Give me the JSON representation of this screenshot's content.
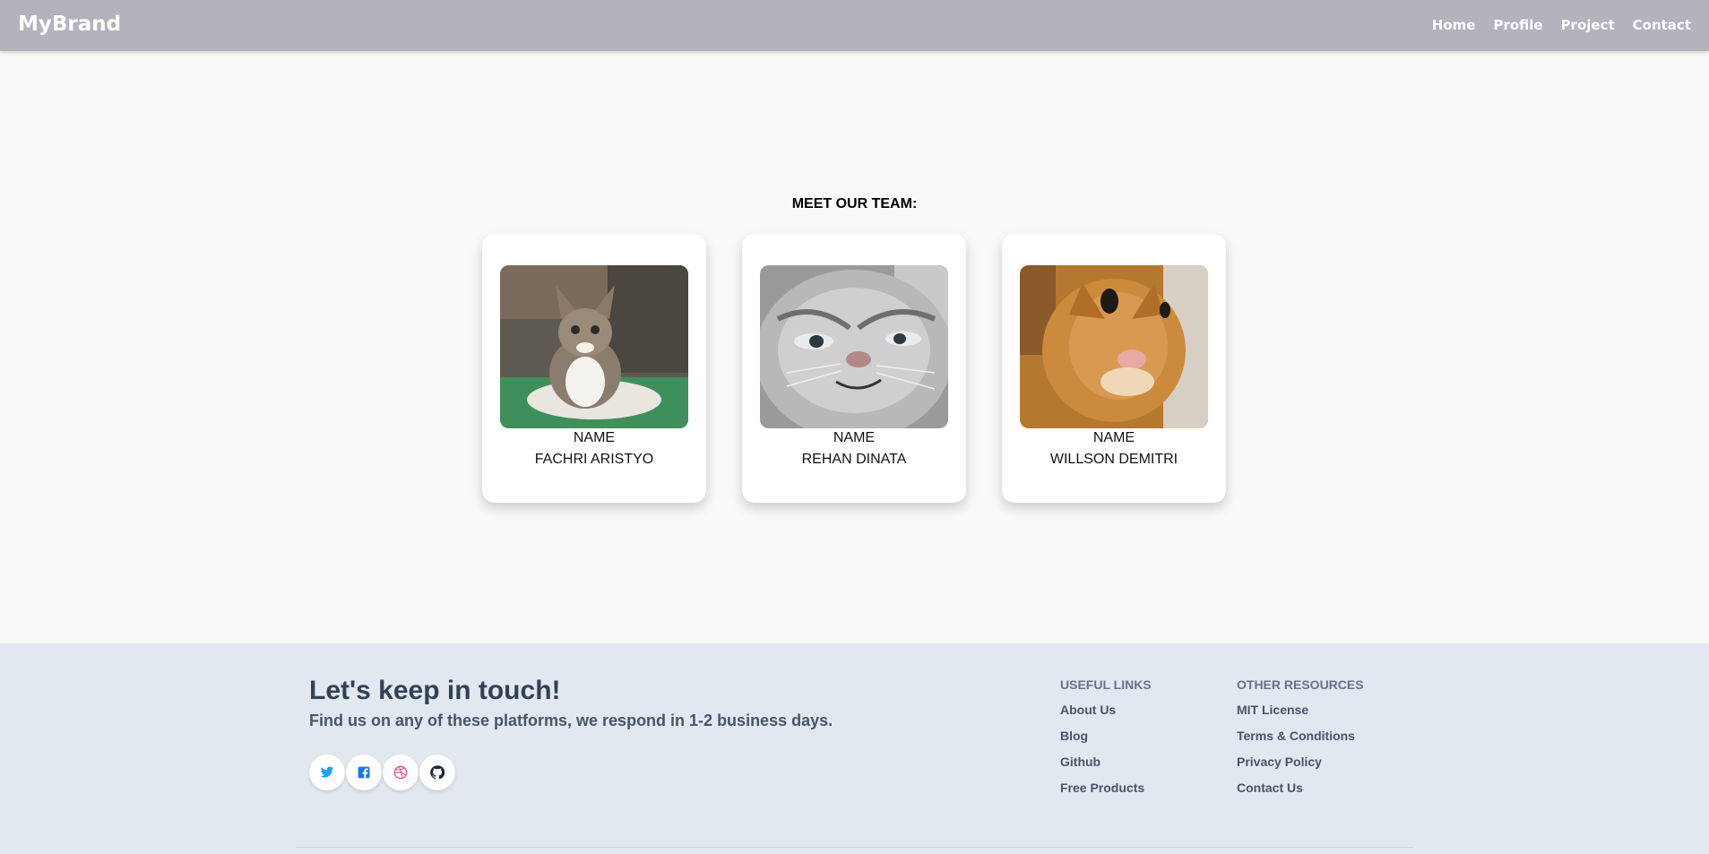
{
  "nav": {
    "brand": "MyBrand",
    "links": [
      "Home",
      "Profile",
      "Project",
      "Contact"
    ]
  },
  "team": {
    "heading": "MEET OUR TEAM:",
    "members": [
      {
        "label": "NAME",
        "name": "FACHRI ARISTYO",
        "photo": "tabby-kitten-photo"
      },
      {
        "label": "NAME",
        "name": "REHAN DINATA",
        "photo": "grey-tabby-cat-photo"
      },
      {
        "label": "NAME",
        "name": "WILLSON DEMITRI",
        "photo": "orange-cat-photo"
      }
    ]
  },
  "footer": {
    "title": "Let's keep in touch!",
    "subtitle": "Find us on any of these platforms, we respond in 1-2 business days.",
    "socials": [
      {
        "icon": "twitter-icon",
        "color": "#1da1f2"
      },
      {
        "icon": "facebook-icon",
        "color": "#1877f2"
      },
      {
        "icon": "dribbble-icon",
        "color": "#ea4c89"
      },
      {
        "icon": "github-icon",
        "color": "#1f2937"
      }
    ],
    "useful_links": {
      "heading": "USEFUL LINKS",
      "items": [
        "About Us",
        "Blog",
        "Github",
        "Free Products"
      ]
    },
    "other_resources": {
      "heading": "OTHER RESOURCES",
      "items": [
        "MIT License",
        "Terms & Conditions",
        "Privacy Policy",
        "Contact Us"
      ]
    }
  },
  "colors": {
    "navbar": "#b3b2bd",
    "page_bg": "#f9f9f9",
    "footer_bg": "#e2e8f0",
    "footer_text": "#334155"
  }
}
